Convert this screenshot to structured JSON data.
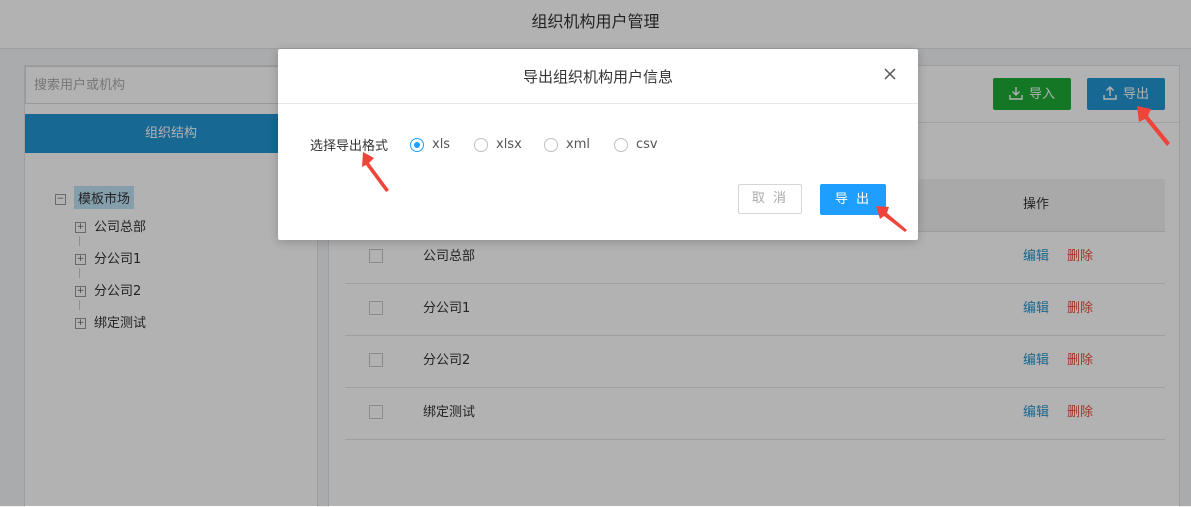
{
  "page": {
    "title": "组织机构用户管理"
  },
  "sidebar": {
    "search_placeholder": "搜索用户或机构",
    "tab_label": "组织结构",
    "tree": {
      "root": {
        "label": "模板市场",
        "toggle": "⊟"
      },
      "children": [
        {
          "label": "公司总部",
          "toggle": "⊞"
        },
        {
          "label": "分公司1",
          "toggle": "⊞"
        },
        {
          "label": "分公司2",
          "toggle": "⊞"
        },
        {
          "label": "绑定测试",
          "toggle": "⊞"
        }
      ]
    }
  },
  "toolbar": {
    "import_label": "导入",
    "import_icon": "download-icon",
    "export_label": "导出",
    "export_icon": "upload-icon"
  },
  "table": {
    "header_ops": "操作",
    "rows": [
      {
        "name": "公司总部",
        "edit": "编辑",
        "delete": "删除"
      },
      {
        "name": "分公司1",
        "edit": "编辑",
        "delete": "删除"
      },
      {
        "name": "分公司2",
        "edit": "编辑",
        "delete": "删除"
      },
      {
        "name": "绑定测试",
        "edit": "编辑",
        "delete": "删除"
      }
    ]
  },
  "modal": {
    "title": "导出组织机构用户信息",
    "close_icon": "close-icon",
    "format_label": "选择导出格式",
    "options": [
      {
        "label": "xls",
        "checked": true
      },
      {
        "label": "xlsx",
        "checked": false
      },
      {
        "label": "xml",
        "checked": false
      },
      {
        "label": "csv",
        "checked": false
      }
    ],
    "cancel_label": "取 消",
    "export_label": "导 出"
  },
  "colors": {
    "primary": "#2196d3",
    "modal_primary": "#1e9fff",
    "import_green": "#1dab37",
    "delete_red": "#e74c3c",
    "annotation_arrow": "#f0443a"
  }
}
